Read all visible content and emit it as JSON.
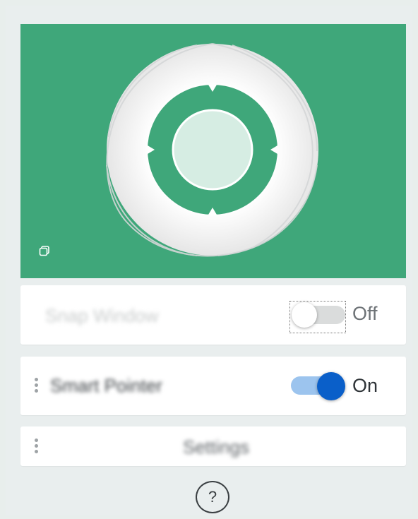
{
  "theme": {
    "accent": "#3fa77a",
    "toggle_on_color": "#0a5fc9"
  },
  "hero": {
    "icon": "camera-shutter-icon",
    "corner_icon": "copy-icon"
  },
  "snap_window": {
    "label": "Snap Window",
    "state": "Off",
    "enabled": false
  },
  "smart_pointer": {
    "label": "Smart Pointer",
    "state": "On",
    "enabled": true
  },
  "settings": {
    "label": "Settings"
  },
  "help": {
    "label": "?"
  }
}
